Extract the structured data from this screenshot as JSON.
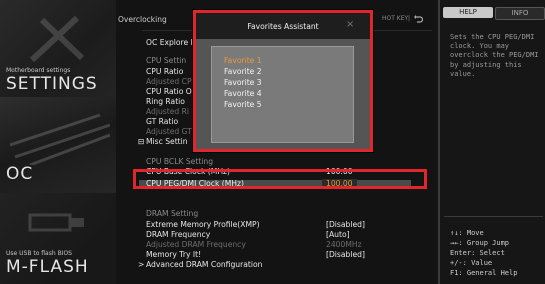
{
  "left_nav": {
    "settings": {
      "sub": "Motherboard settings",
      "title": "SETTINGS"
    },
    "oc": {
      "title": "OC"
    },
    "mflash": {
      "sub": "Use USB to flash BIOS",
      "title": "M-FLASH"
    }
  },
  "header": {
    "breadcrumb": "Overclocking",
    "hotkey": "HOT KEY",
    "separator": "|",
    "back_icon": "undo-icon"
  },
  "main": {
    "oc_explore_label": "OC Explore M",
    "cpu_settings_section": "CPU Settin",
    "cpu_ratio": "CPU Ratio",
    "adjusted_cpu": "Adjusted CP",
    "cpu_ratio_offset": "CPU Ratio O",
    "ring_ratio": "Ring Ratio",
    "adjusted_ring": "Adjusted Ri",
    "gt_ratio": "GT Ratio",
    "adjusted_gt": "Adjusted GT",
    "misc_settings": "Misc Settin",
    "misc_toggle": "⊟",
    "bclk_section": "CPU BCLK Setting",
    "cpu_base_clock": "CPU Base Clock (MHz)",
    "cpu_base_clock_value": "100.00",
    "pcie_clock": "CPU PEG/DMI Clock (MHz)",
    "pcie_clock_value": "100.00",
    "dram_section": "DRAM Setting",
    "xmp_label": "Extreme Memory Profile(XMP)",
    "xmp_value": "[Disabled]",
    "dram_freq_label": "DRAM Frequency",
    "dram_freq_value": "[Auto]",
    "adj_dram_label": "Adjusted DRAM Frequency",
    "adj_dram_value": "2400MHz",
    "mem_try_label": "Memory Try It!",
    "mem_try_value": "[Disabled]",
    "adv_dram_label": "Advanced DRAM Configuration",
    "adv_dram_arrow": ">"
  },
  "popup": {
    "title": "Favorites Assistant",
    "close": "×",
    "items": [
      "Favorite 1",
      "Favorite 2",
      "Favorite 3",
      "Favorite 4",
      "Favorite 5"
    ]
  },
  "help": {
    "tab_help": "HELP",
    "tab_info": "INFO",
    "text": "Sets the CPU PEG/DMI clock. You may overclock the PEG/DMI by adjusting this value.",
    "keys": [
      "↑↓: Move",
      "→←: Group Jump",
      "Enter: Select",
      "+/-: Value",
      "F1: General Help"
    ]
  },
  "colors": {
    "highlight": "#e0262a",
    "selected_text": "#e89a3a"
  }
}
